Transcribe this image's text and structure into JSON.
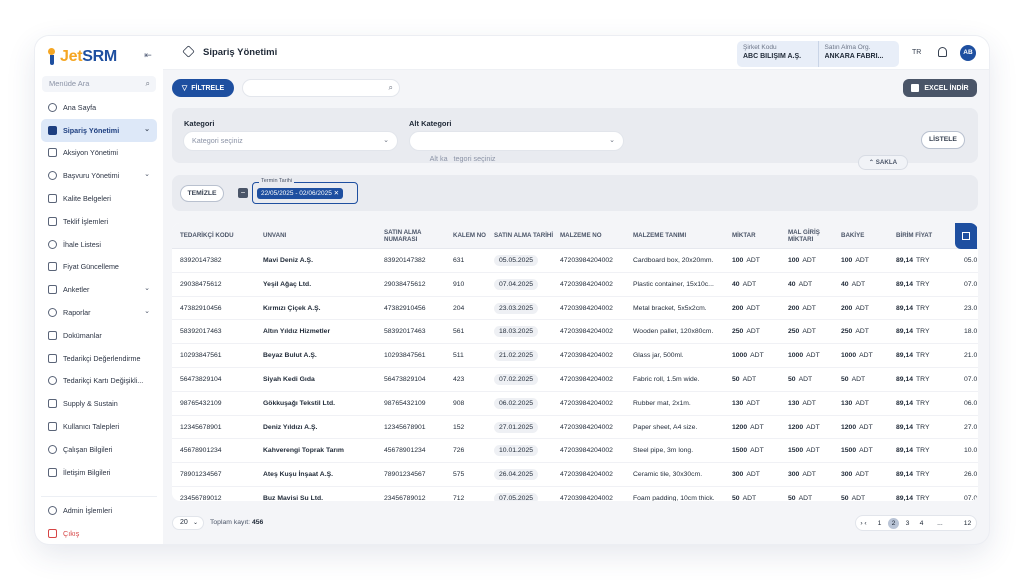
{
  "app": {
    "logo_j": "J",
    "logo_rest": "et",
    "logo_srm": "SRM",
    "collapse_glyph": "⇤"
  },
  "sidebar": {
    "search_placeholder": "Menüde Ara",
    "items": [
      {
        "label": "Ana Sayfa",
        "icon": "home-icon",
        "active": false,
        "chevron": false
      },
      {
        "label": "Sipariş Yönetimi",
        "icon": "cube-icon",
        "active": true,
        "chevron": true
      },
      {
        "label": "Aksiyon Yönetimi",
        "icon": "action-icon",
        "active": false,
        "chevron": false
      },
      {
        "label": "Başvuru Yönetimi",
        "icon": "application-icon",
        "active": false,
        "chevron": true
      },
      {
        "label": "Kalite Belgeleri",
        "icon": "certificate-icon",
        "active": false,
        "chevron": false
      },
      {
        "label": "Teklif İşlemleri",
        "icon": "offer-icon",
        "active": false,
        "chevron": false
      },
      {
        "label": "İhale Listesi",
        "icon": "tender-icon",
        "active": false,
        "chevron": false
      },
      {
        "label": "Fiyat Güncelleme",
        "icon": "price-icon",
        "active": false,
        "chevron": false
      },
      {
        "label": "Anketler",
        "icon": "survey-icon",
        "active": false,
        "chevron": true
      },
      {
        "label": "Raporlar",
        "icon": "report-icon",
        "active": false,
        "chevron": true
      },
      {
        "label": "Dokümanlar",
        "icon": "document-icon",
        "active": false,
        "chevron": false
      },
      {
        "label": "Tedarikçi Değerlendirme",
        "icon": "trophy-icon",
        "active": false,
        "chevron": false
      },
      {
        "label": "Tedarikçi Kartı Değişikli...",
        "icon": "card-icon",
        "active": false,
        "chevron": false
      },
      {
        "label": "Supply & Sustain",
        "icon": "leaf-icon",
        "active": false,
        "chevron": false
      },
      {
        "label": "Kullanıcı Talepleri",
        "icon": "user-request-icon",
        "active": false,
        "chevron": false
      },
      {
        "label": "Çalışan Bilgileri",
        "icon": "employee-icon",
        "active": false,
        "chevron": false
      },
      {
        "label": "İletişim Bilgileri",
        "icon": "contact-icon",
        "active": false,
        "chevron": false
      }
    ],
    "admin_label": "Admin İşlemleri",
    "logout_label": "Çıkış"
  },
  "header": {
    "title": "Sipariş Yönetimi",
    "company_code_label": "Şirket Kodu",
    "company_code_value": "ABC BİLİŞİM A.Ş.",
    "purchase_org_label": "Satın Alma Org.",
    "purchase_org_value": "ANKARA FABRİ...",
    "lang": "TR",
    "avatar": "AB"
  },
  "toolbar": {
    "filter_label": "FİLTRELE",
    "search_placeholder": "",
    "excel_label": "EXCEL İNDİR"
  },
  "filters": {
    "category_label": "Kategori",
    "category_placeholder": "Kategori seçiniz",
    "subcategory_label": "Alt Kategori",
    "subcategory_placeholder": "Alt ka   tegori seçiniz",
    "list_label": "LİSTELE",
    "collapse_label": "SAKLA",
    "clear_label": "TEMİZLE",
    "date_chip_label": "Termin Tarihi",
    "date_chip_value": "22/05/2025 - 02/06/2025"
  },
  "table": {
    "headers": [
      "TEDARİKÇİ KODU",
      "UNVANI",
      "SATIN ALMA NUMARASI",
      "KALEM NO",
      "SATIN ALMA TARİHİ",
      "MALZEME NO",
      "MALZEME TANIMI",
      "MİKTAR",
      "MAL GİRİŞ MİKTARI",
      "BAKİYE",
      "BİRİM FİYAT"
    ],
    "rows": [
      {
        "code": "83920147382",
        "name": "Mavi Deniz A.Ş.",
        "po": "83920147382",
        "item": "631",
        "date": "05.05.2025",
        "mat": "47203984204002",
        "desc": "Cardboard box, 20x20mm.",
        "qty": "100",
        "gr": "100",
        "bal": "100",
        "price": "89,14",
        "cur": "TRY",
        "extra": "05.0"
      },
      {
        "code": "29038475612",
        "name": "Yeşil Ağaç Ltd.",
        "po": "29038475612",
        "item": "910",
        "date": "07.04.2025",
        "mat": "47203984204002",
        "desc": "Plastic container, 15x10c...",
        "qty": "40",
        "gr": "40",
        "bal": "40",
        "price": "89,14",
        "cur": "TRY",
        "extra": "07.0"
      },
      {
        "code": "47382910456",
        "name": "Kırmızı Çiçek A.Ş.",
        "po": "47382910456",
        "item": "204",
        "date": "23.03.2025",
        "mat": "47203984204002",
        "desc": "Metal bracket, 5x5x2cm.",
        "qty": "200",
        "gr": "200",
        "bal": "200",
        "price": "89,14",
        "cur": "TRY",
        "extra": "23.0"
      },
      {
        "code": "58392017463",
        "name": "Altın Yıldız Hizmetler",
        "po": "58392017463",
        "item": "561",
        "date": "18.03.2025",
        "mat": "47203984204002",
        "desc": "Wooden pallet, 120x80cm.",
        "qty": "250",
        "gr": "250",
        "bal": "250",
        "price": "89,14",
        "cur": "TRY",
        "extra": "18.0"
      },
      {
        "code": "10293847561",
        "name": "Beyaz Bulut A.Ş.",
        "po": "10293847561",
        "item": "511",
        "date": "21.02.2025",
        "mat": "47203984204002",
        "desc": "Glass jar, 500ml.",
        "qty": "1000",
        "gr": "1000",
        "bal": "1000",
        "price": "89,14",
        "cur": "TRY",
        "extra": "21.0"
      },
      {
        "code": "56473829104",
        "name": "Siyah Kedi Gıda",
        "po": "56473829104",
        "item": "423",
        "date": "07.02.2025",
        "mat": "47203984204002",
        "desc": "Fabric roll, 1.5m wide.",
        "qty": "50",
        "gr": "50",
        "bal": "50",
        "price": "89,14",
        "cur": "TRY",
        "extra": "07.0"
      },
      {
        "code": "98765432109",
        "name": "Gökkuşağı Tekstil Ltd.",
        "po": "98765432109",
        "item": "908",
        "date": "06.02.2025",
        "mat": "47203984204002",
        "desc": "Rubber mat, 2x1m.",
        "qty": "130",
        "gr": "130",
        "bal": "130",
        "price": "89,14",
        "cur": "TRY",
        "extra": "06.0"
      },
      {
        "code": "12345678901",
        "name": "Deniz Yıldızı A.Ş.",
        "po": "12345678901",
        "item": "152",
        "date": "27.01.2025",
        "mat": "47203984204002",
        "desc": "Paper sheet, A4 size.",
        "qty": "1200",
        "gr": "1200",
        "bal": "1200",
        "price": "89,14",
        "cur": "TRY",
        "extra": "27.0"
      },
      {
        "code": "45678901234",
        "name": "Kahverengi Toprak Tarım",
        "po": "45678901234",
        "item": "726",
        "date": "10.01.2025",
        "mat": "47203984204002",
        "desc": "Steel pipe, 3m long.",
        "qty": "1500",
        "gr": "1500",
        "bal": "1500",
        "price": "89,14",
        "cur": "TRY",
        "extra": "10.0"
      },
      {
        "code": "78901234567",
        "name": "Ateş Kuşu İnşaat A.Ş.",
        "po": "78901234567",
        "item": "575",
        "date": "26.04.2025",
        "mat": "47203984204002",
        "desc": "Ceramic tile, 30x30cm.",
        "qty": "300",
        "gr": "300",
        "bal": "300",
        "price": "89,14",
        "cur": "TRY",
        "extra": "26.0"
      },
      {
        "code": "23456789012",
        "name": "Buz Mavisi Su Ltd.",
        "po": "23456789012",
        "item": "712",
        "date": "07.05.2025",
        "mat": "47203984204002",
        "desc": "Foam padding, 10cm thick.",
        "qty": "50",
        "gr": "50",
        "bal": "50",
        "price": "89,14",
        "cur": "TRY",
        "extra": "07.0"
      }
    ],
    "unit": "ADT"
  },
  "footer": {
    "page_size": "20",
    "total_label": "Toplam kayıt:",
    "total_value": "456",
    "pages": [
      "1",
      "2",
      "3",
      "4",
      "...",
      "12"
    ],
    "active_page": "2",
    "prev": "‹",
    "next": "›"
  },
  "colors": {
    "primary": "#1e4fa0",
    "accent": "#f5a623",
    "danger": "#d64545"
  }
}
